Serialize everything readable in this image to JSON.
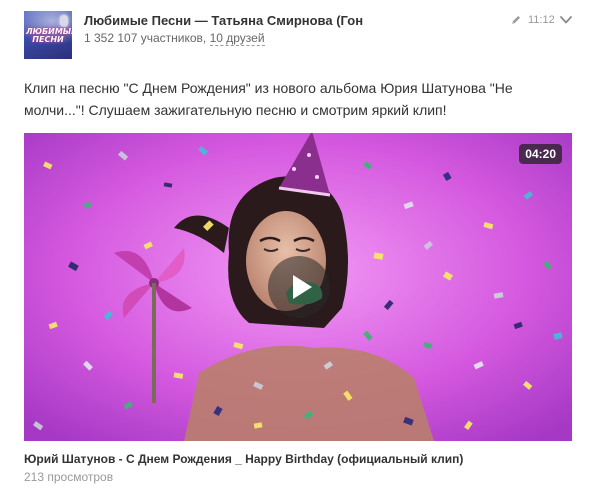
{
  "group": {
    "name": "Любимые Песни — Татьяна Смирнова (Гон",
    "members": "1 352 107 участников",
    "separator": ", ",
    "friends": "10 друзей",
    "avatar_text": "ЛЮБИМЫЕ ПЕСНИ",
    "avatar_icon": "microphone-logo"
  },
  "post": {
    "time": "11:12",
    "text": "Клип на песню \"С Днем Рождения\" из нового альбома Юрия Шатунова \"Не молчи...\"! Слушаем зажигательную песню и смотрим яркий клип!",
    "edit_icon": "pencil-icon",
    "menu_icon": "chevron-down-icon"
  },
  "video": {
    "duration": "04:20",
    "title": "Юрий Шатунов - С Днем Рождения _ Happy Birthday (официальный клип)",
    "views": "213 просмотров",
    "play_icon": "play-icon",
    "background_color": "#d853e0"
  },
  "colors": {
    "text": "#333333",
    "muted": "#999999",
    "meta": "#666666"
  }
}
